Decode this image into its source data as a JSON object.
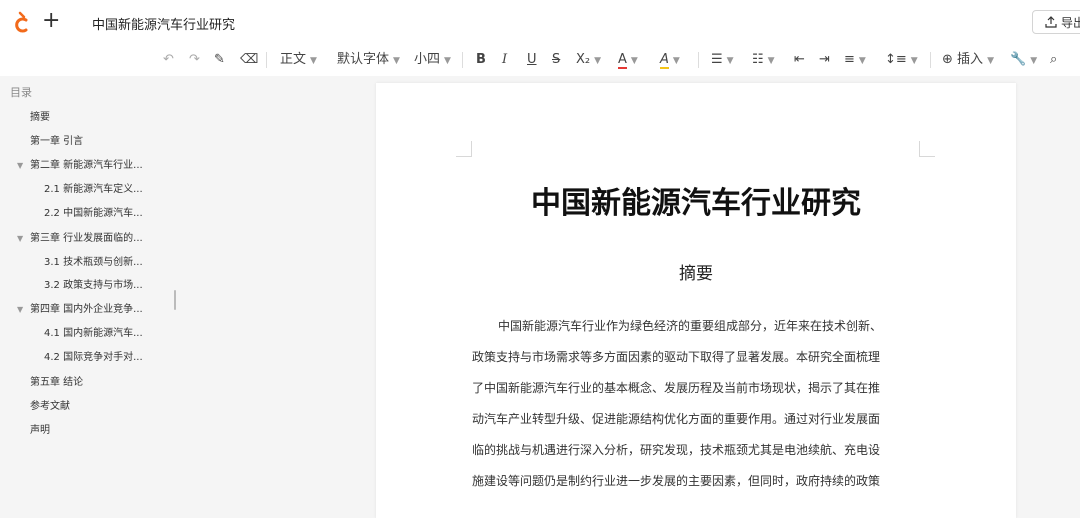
{
  "app": {
    "title": "中国新能源汽车行业研究",
    "new_icon": "plus-icon",
    "logo_icon": "app-logo-icon",
    "export_label": "导出",
    "accent": "#f26a1b"
  },
  "toolbar": {
    "style_select": "正文",
    "font_select": "默认字体",
    "size_select": "小四",
    "insert_label": "插入",
    "bold": "B",
    "italic": "I",
    "underline": "U",
    "strike": "S",
    "subscript": "X₂",
    "font_color": "A",
    "highlight": "A"
  },
  "toc": {
    "title": "目录",
    "items": [
      {
        "label": "摘要",
        "level": 1,
        "expandable": false
      },
      {
        "label": "第一章 引言",
        "level": 1,
        "expandable": false
      },
      {
        "label": "第二章 新能源汽车行业...",
        "level": 1,
        "expandable": true
      },
      {
        "label": "2.1 新能源汽车定义...",
        "level": 2,
        "expandable": false
      },
      {
        "label": "2.2 中国新能源汽车...",
        "level": 2,
        "expandable": false
      },
      {
        "label": "第三章 行业发展面临的...",
        "level": 1,
        "expandable": true
      },
      {
        "label": "3.1 技术瓶颈与创新...",
        "level": 2,
        "expandable": false
      },
      {
        "label": "3.2 政策支持与市场...",
        "level": 2,
        "expandable": false
      },
      {
        "label": "第四章 国内外企业竞争...",
        "level": 1,
        "expandable": true
      },
      {
        "label": "4.1 国内新能源汽车...",
        "level": 2,
        "expandable": false
      },
      {
        "label": "4.2 国际竞争对手对...",
        "level": 2,
        "expandable": false
      },
      {
        "label": "第五章 结论",
        "level": 1,
        "expandable": false
      },
      {
        "label": "参考文献",
        "level": 1,
        "expandable": false
      },
      {
        "label": "声明",
        "level": 1,
        "expandable": false
      }
    ]
  },
  "document": {
    "title": "中国新能源汽车行业研究",
    "section_heading": "摘要",
    "paragraph_lines": [
      "中国新能源汽车行业作为绿色经济的重要组成部分，近年来在技术创新、",
      "政策支持与市场需求等多方面因素的驱动下取得了显著发展。本研究全面梳理",
      "了中国新能源汽车行业的基本概念、发展历程及当前市场现状，揭示了其在推",
      "动汽车产业转型升级、促进能源结构优化方面的重要作用。通过对行业发展面",
      "临的挑战与机遇进行深入分析，研究发现，技术瓶颈尤其是电池续航、充电设",
      "施建设等问题仍是制约行业进一步发展的主要因素，但同时，政府持续的政策"
    ]
  }
}
